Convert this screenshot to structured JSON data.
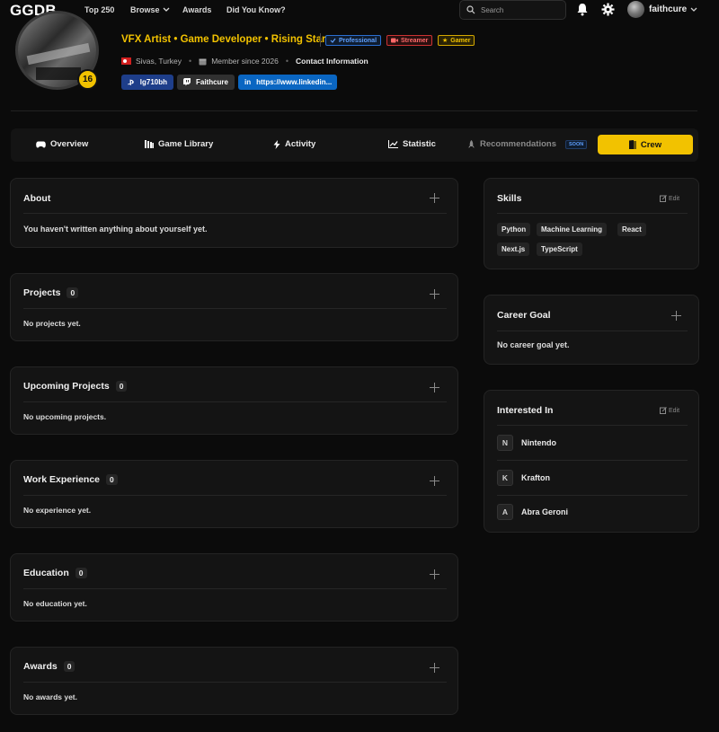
{
  "nav": {
    "logo": "GGDB",
    "links": [
      "Top 250",
      "Browse",
      "Awards",
      "Did You Know?"
    ],
    "search_placeholder": "Search",
    "username": "faithcure"
  },
  "profile": {
    "level": "16",
    "headline": "VFX Artist • Game Developer • Rising Star",
    "tags": {
      "pro": "Professional",
      "streamer": "Streamer",
      "gamer": "Gamer"
    },
    "location": "Sivas, Turkey",
    "member_since": "Member since 2026",
    "contact": "Contact Information",
    "socials": {
      "psn": "lg710bh",
      "twitch": "Faithcure",
      "linkedin": "https://www.linkedin..."
    }
  },
  "tabs": {
    "overview": "Overview",
    "library": "Game Library",
    "activity": "Activity",
    "statistic": "Statistic",
    "recommendations": "Recommendations",
    "soon": "SOON",
    "crew": "Crew"
  },
  "about": {
    "title": "About",
    "body": "You haven't written anything about yourself yet."
  },
  "projects": {
    "title": "Projects",
    "count": "0",
    "body": "No projects yet."
  },
  "upcoming": {
    "title": "Upcoming Projects",
    "count": "0",
    "body": "No upcoming projects."
  },
  "experience": {
    "title": "Work Experience",
    "count": "0",
    "body": "No experience yet."
  },
  "education": {
    "title": "Education",
    "count": "0",
    "body": "No education yet."
  },
  "awards": {
    "title": "Awards",
    "count": "0",
    "body": "No awards yet."
  },
  "skills": {
    "title": "Skills",
    "edit": "Edit",
    "items": [
      "Python",
      "Machine Learning",
      "React",
      "Next.js",
      "TypeScript"
    ]
  },
  "career": {
    "title": "Career Goal",
    "body": "No career goal yet."
  },
  "interested": {
    "title": "Interested In",
    "edit": "Edit",
    "items": [
      {
        "letter": "N",
        "name": "Nintendo"
      },
      {
        "letter": "K",
        "name": "Krafton"
      },
      {
        "letter": "A",
        "name": "Abra Geroni"
      }
    ]
  },
  "colors": {
    "accent": "#f2c200",
    "background": "#0b0b0b",
    "card": "#141414"
  }
}
